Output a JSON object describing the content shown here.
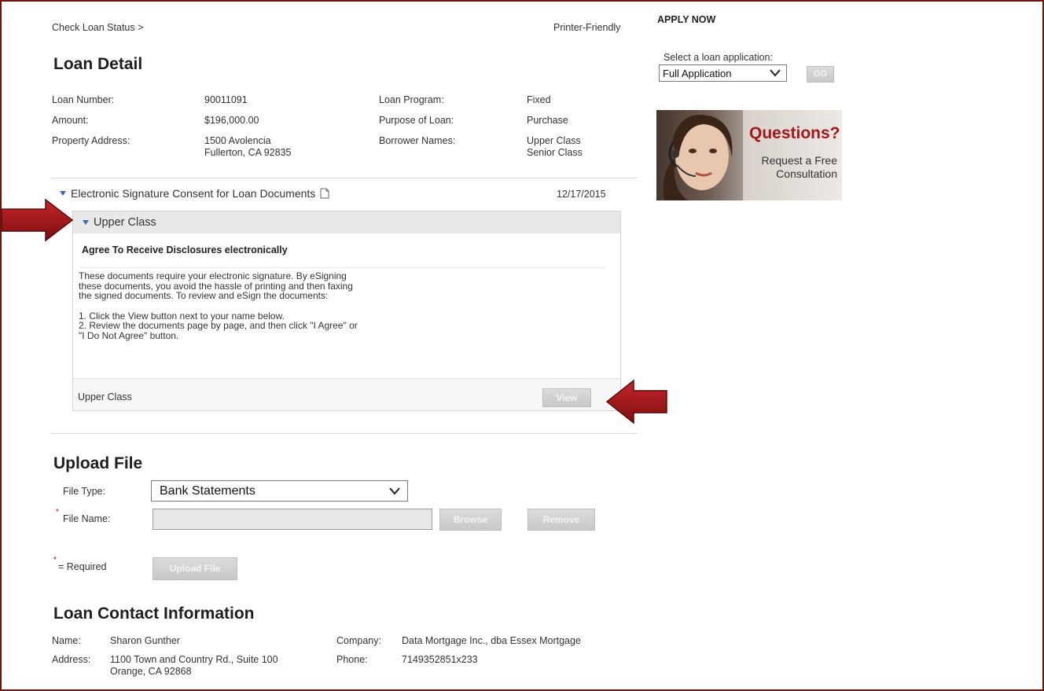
{
  "breadcrumb": "Check Loan Status >",
  "printer_friendly": "Printer-Friendly",
  "loan_detail": {
    "title": "Loan Detail",
    "rows": [
      {
        "label1": "Loan Number:",
        "value1": "90011091",
        "label2": "Loan Program:",
        "value2": "Fixed"
      },
      {
        "label1": "Amount:",
        "value1": "$196,000.00",
        "label2": "Purpose of Loan:",
        "value2": "Purchase"
      },
      {
        "label1": "Property Address:",
        "value1_line1": "1500 Avolencia",
        "value1_line2": "Fullerton, CA 92835",
        "label2": "Borrower Names:",
        "value2_line1": "Upper Class",
        "value2_line2": "Senior Class"
      }
    ]
  },
  "esign": {
    "section_title": "Electronic Signature Consent for Loan Documents",
    "date": "12/17/2015",
    "borrower_header": "Upper Class",
    "agree_title": "Agree To Receive Disclosures electronically",
    "body_lines": [
      "These documents require your electronic signature. By eSigning",
      "these documents, you avoid the hassle of printing and then faxing",
      "the signed documents. To review and eSign the documents:",
      "",
      "1. Click the View button next to your name below.",
      "2. Review the documents page by page, and then click \"I Agree\" or",
      "\"I Do Not Agree\" button."
    ],
    "signer_name": "Upper Class",
    "view_button": "View"
  },
  "upload": {
    "title": "Upload File",
    "file_type_label": "File Type:",
    "file_type_value": "Bank Statements",
    "file_name_label": "File Name:",
    "browse_button": "Browse",
    "remove_button": "Remove",
    "required_note": "= Required",
    "required_star": "*",
    "upload_button": "Upload File"
  },
  "contact": {
    "title": "Loan Contact Information",
    "name_label": "Name:",
    "name_value": "Sharon Gunther",
    "address_label": "Address:",
    "address_line1": "1100 Town and Country Rd., Suite 100",
    "address_line2": "Orange, CA 92868",
    "company_label": "Company:",
    "company_value": "Data Mortgage Inc., dba Essex Mortgage",
    "phone_label": "Phone:",
    "phone_value": "7149352851x233"
  },
  "sidebar": {
    "apply_now": "APPLY NOW",
    "select_label": "Select a loan application:",
    "select_value": "Full Application",
    "go_button": "GO",
    "ad_title": "Questions?",
    "ad_line1": "Request a Free",
    "ad_line2": "Consultation"
  },
  "colors": {
    "accent_red": "#a4161a",
    "frame": "#6b1410",
    "link_blue": "#3a6fb7"
  }
}
